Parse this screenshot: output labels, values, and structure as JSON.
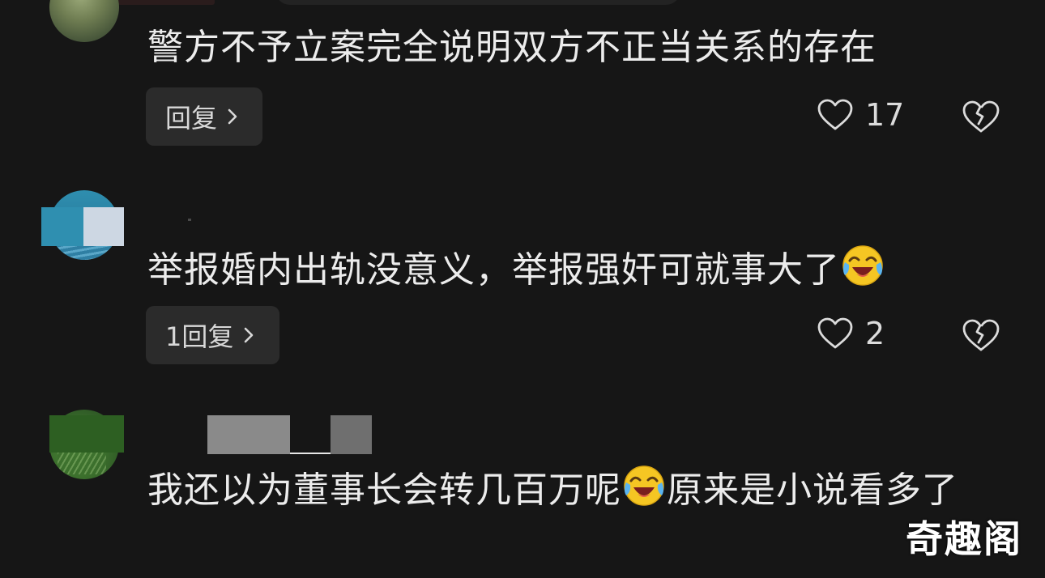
{
  "comments": [
    {
      "text": "警方不予立案完全说明双方不正当关系的存在",
      "reply_label": "回复",
      "likes": "17"
    },
    {
      "text": "举报婚内出轨没意义，举报强奸可就事大了",
      "emoji": "laughing-crying-emoji",
      "reply_label": "1回复",
      "likes": "2"
    },
    {
      "text_before_emoji": "我还以为董事长会转几百万呢",
      "emoji": "laughing-crying-emoji",
      "text_after_emoji": "原来是小说看多了"
    }
  ],
  "watermark": "奇趣阁",
  "colors": {
    "background": "#161616",
    "reply_button": "#2b2b2b",
    "text": "#ececec",
    "emoji_face": "#f5c623"
  }
}
